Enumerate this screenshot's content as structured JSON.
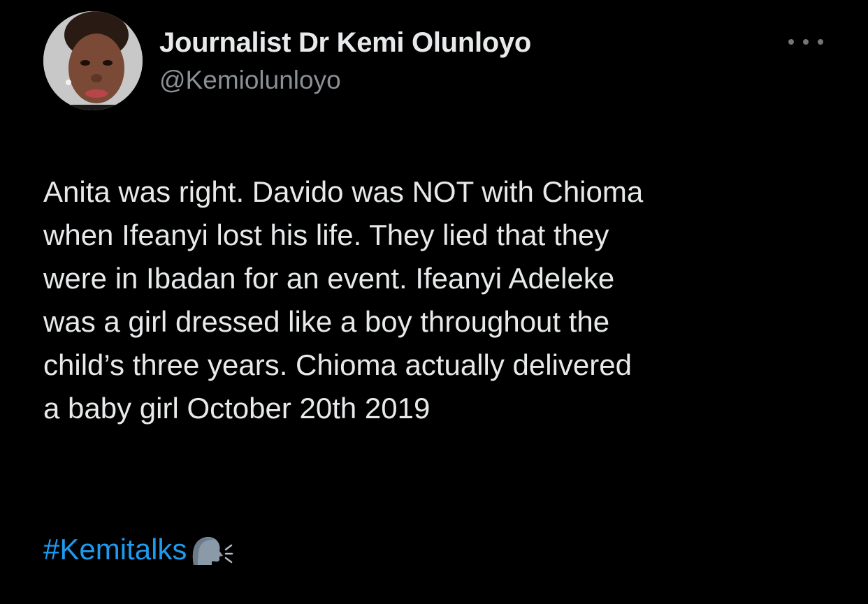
{
  "author": {
    "display_name": "Journalist Dr Kemi Olunloyo",
    "handle": "@Kemiolunloyo",
    "avatar": "profile-photo"
  },
  "more_icon": "ellipsis-icon",
  "tweet": {
    "lines": [
      "Anita was right. Davido was NOT with Chioma",
      "when Ifeanyi lost his life. They lied that they",
      "were in Ibadan for an event.  Ifeanyi Adeleke",
      "was a girl dressed like a boy throughout the",
      "child’s three years. Chioma actually delivered",
      "a baby girl October 20th 2019"
    ],
    "hashtag": "#Kemitalks",
    "emoji": "speaking-head-icon"
  },
  "colors": {
    "background": "#000000",
    "text": "#e7e9ea",
    "secondary_text": "#8b9096",
    "link": "#1d9bf0"
  }
}
